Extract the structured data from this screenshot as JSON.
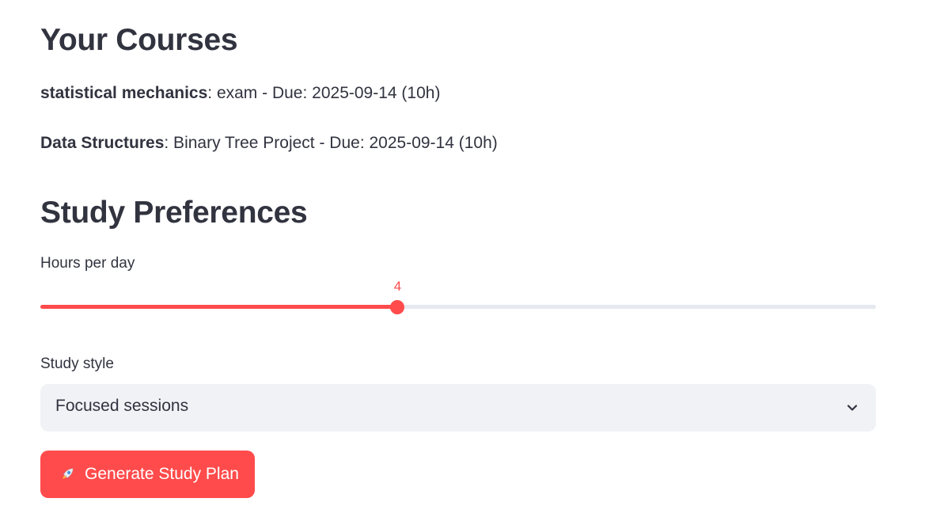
{
  "courses_section": {
    "title": "Your Courses",
    "courses": [
      {
        "name": "statistical mechanics",
        "detail": ": exam - Due: 2025-09-14 (10h)"
      },
      {
        "name": "Data Structures",
        "detail": ": Binary Tree Project - Due: 2025-09-14 (10h)"
      }
    ]
  },
  "preferences_section": {
    "title": "Study Preferences",
    "hours_slider": {
      "label": "Hours per day",
      "value": "4",
      "fill_fraction": 0.4275
    },
    "study_style": {
      "label": "Study style",
      "selected": "Focused sessions"
    },
    "generate_button": {
      "label": "Generate Study Plan",
      "icon": "rocket-icon"
    }
  },
  "colors": {
    "accent": "#ff4b4b",
    "text": "#31333f",
    "track": "#e6e9ef",
    "select_bg": "#f0f2f6"
  }
}
